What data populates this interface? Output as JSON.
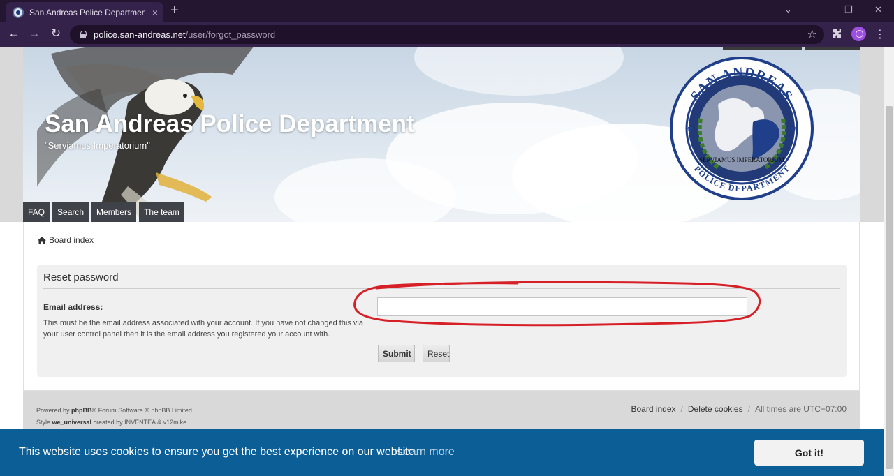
{
  "browser": {
    "tab_title": "San Andreas Police Department -",
    "tab_close": "×",
    "new_tab": "+",
    "url_host": "police.san-andreas.net",
    "url_path": "/user/forgot_password",
    "window_controls": [
      "⌄",
      "—",
      "❐",
      "✕"
    ],
    "nav": {
      "back": "←",
      "forward": "→",
      "reload": "↻"
    },
    "star": "☆",
    "menu": "⋮"
  },
  "header": {
    "site_title": "San Andreas Police Department",
    "site_description": "\"Serviamus Imperatorium\"",
    "seal": {
      "top_text": "SAN ANDREAS",
      "bottom_text": "POLICE DEPARTMENT",
      "motto": "SERVIAMUS IMPERATORIUM"
    },
    "nav": [
      {
        "label": "FAQ"
      },
      {
        "label": "Search"
      },
      {
        "label": "Members"
      },
      {
        "label": "The team"
      }
    ]
  },
  "breadcrumb": {
    "label": "Board index",
    "icon": "home-icon"
  },
  "form": {
    "title": "Reset password",
    "email_label": "Email address:",
    "email_explain": "This must be the email address associated with your account. If you have not changed this via your user control panel then it is the email address you registered your account with.",
    "email_value": "",
    "email_placeholder": "",
    "submit_label": "Submit",
    "reset_label": "Reset"
  },
  "footer": {
    "powered_prefix": "Powered by",
    "powered_brand": "phpBB",
    "powered_suffix": "® Forum Software © phpBB Limited",
    "style_prefix": "Style",
    "style_name": "we_universal",
    "style_suffix": "created by INVENTEA & v12mike",
    "links": [
      "Board index",
      "Delete cookies"
    ],
    "timezone": "All times are UTC+07:00"
  },
  "cookie": {
    "message": "This website uses cookies to ensure you get the best experience on our website.",
    "learn_more": "Learn more",
    "accept": "Got it!"
  },
  "colors": {
    "tab_bar": "#241530",
    "toolbar": "#35224a",
    "menu_button": "#3f4349",
    "cookie_bar": "#0b5e96",
    "highlight_ring": "#d61f26"
  }
}
